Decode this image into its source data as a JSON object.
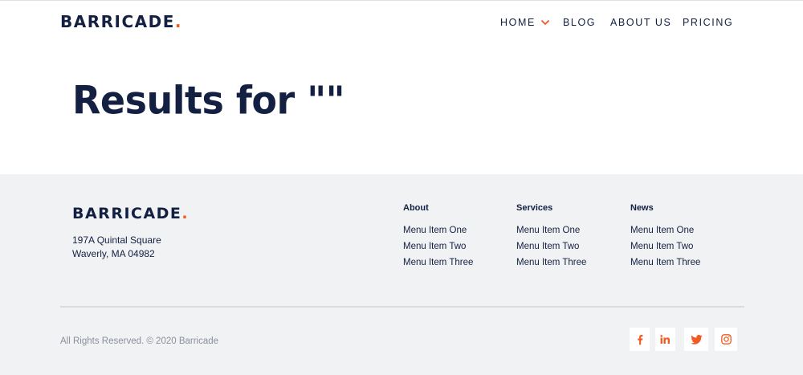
{
  "header": {
    "logo_text": "BARRICADE",
    "logo_dot": ".",
    "nav": [
      {
        "label": "HOME",
        "has_dropdown": true
      },
      {
        "label": "BLOG"
      },
      {
        "label": "ABOUT US"
      },
      {
        "label": "PRICING"
      }
    ]
  },
  "main": {
    "title": "Results for \"\""
  },
  "footer": {
    "logo_text": "BARRICADE",
    "logo_dot": ".",
    "address_line1": "197A Quintal Square",
    "address_line2": "Waverly, MA 04982",
    "columns": [
      {
        "heading": "About",
        "links": [
          "Menu Item One",
          "Menu Item Two",
          "Menu Item Three"
        ]
      },
      {
        "heading": "Services",
        "links": [
          "Menu Item One",
          "Menu Item Two",
          "Menu Item Three"
        ]
      },
      {
        "heading": "News",
        "links": [
          "Menu Item One",
          "Menu Item Two",
          "Menu Item Three"
        ]
      }
    ],
    "copyright": "All Rights Reserved. © 2020 Barricade",
    "social": [
      "facebook-icon",
      "linkedin-icon",
      "twitter-icon",
      "instagram-icon"
    ]
  },
  "colors": {
    "brand_navy": "#132042",
    "accent_orange": "#f15a22",
    "footer_bg": "#f1f2f4"
  }
}
